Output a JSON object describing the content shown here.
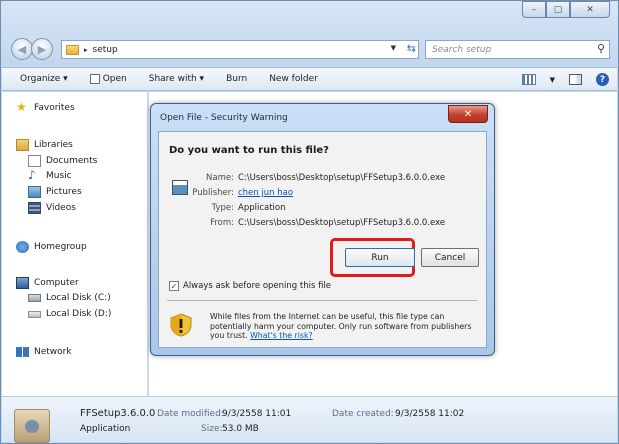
{
  "window": {
    "caption_buttons": {
      "minimize": "–",
      "maximize": "▢",
      "close": "✕"
    }
  },
  "address": {
    "path": "setup",
    "search_placeholder": "Search setup"
  },
  "toolbar": {
    "organize": "Organize ▾",
    "open": "Open",
    "share_with": "Share with ▾",
    "burn": "Burn",
    "new_folder": "New folder"
  },
  "sidebar": {
    "favorites": "Favorites",
    "libraries": "Libraries",
    "documents": "Documents",
    "music": "Music",
    "pictures": "Pictures",
    "videos": "Videos",
    "homegroup": "Homegroup",
    "computer": "Computer",
    "local_disk_c": "Local Disk (C:)",
    "local_disk_d": "Local Disk (D:)",
    "network": "Network"
  },
  "details": {
    "filename": "FFSetup3.6.0.0",
    "type": "Application",
    "modified_label": "Date modified:",
    "modified_value": "9/3/2558 11:01",
    "size_label": "Size:",
    "size_value": "53.0 MB",
    "created_label": "Date created:",
    "created_value": "9/3/2558 11:02"
  },
  "dialog": {
    "title": "Open File - Security Warning",
    "close": "✕",
    "question": "Do you want to run this file?",
    "fields": {
      "name_label": "Name:",
      "name_value": "C:\\Users\\boss\\Desktop\\setup\\FFSetup3.6.0.0.exe",
      "publisher_label": "Publisher:",
      "publisher_value": "chen jun hao",
      "type_label": "Type:",
      "type_value": "Application",
      "from_label": "From:",
      "from_value": "C:\\Users\\boss\\Desktop\\setup\\FFSetup3.6.0.0.exe"
    },
    "run_label": "Run",
    "cancel_label": "Cancel",
    "checkbox_label": "Always ask before opening this file",
    "checkbox_checked": true,
    "warning_text": "While files from the Internet can be useful, this file type can potentially harm your computer. Only run software from publishers you trust.",
    "warning_link": "What's the risk?"
  },
  "colors": {
    "highlight": "#e01919",
    "link": "#0a52b5",
    "dialog_close": "#c4402b"
  }
}
